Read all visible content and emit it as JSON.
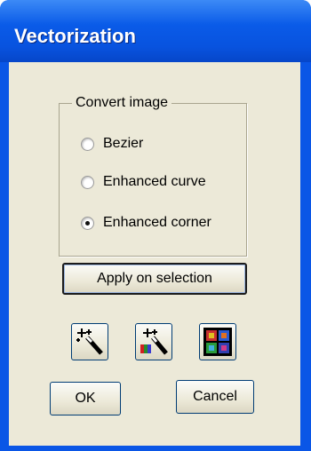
{
  "window": {
    "title": "Vectorization"
  },
  "group": {
    "legend": "Convert image",
    "options": [
      {
        "label": "Bezier",
        "selected": false
      },
      {
        "label": "Enhanced curve",
        "selected": false
      },
      {
        "label": "Enhanced corner",
        "selected": true
      }
    ]
  },
  "buttons": {
    "apply": "Apply on selection",
    "ok": "OK",
    "cancel": "Cancel"
  },
  "tool_icons": [
    "magic-wand-icon",
    "magic-wand-color-icon",
    "color-grid-icon"
  ]
}
